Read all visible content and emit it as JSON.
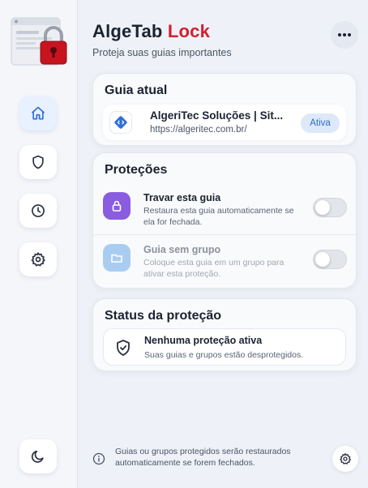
{
  "app": {
    "title_main": "AlgeTab",
    "title_accent": "Lock",
    "subtitle": "Proteja suas guias importantes",
    "accent_color": "#d0202e"
  },
  "sidebar": {
    "items": [
      {
        "icon": "home-icon",
        "active": true
      },
      {
        "icon": "shield-icon",
        "active": false
      },
      {
        "icon": "clock-icon",
        "active": false
      },
      {
        "icon": "gear-icon",
        "active": false
      }
    ],
    "bottom_icon": "moon-icon"
  },
  "current_tab": {
    "heading": "Guia atual",
    "title": "AlgeriTec Soluções | Sit...",
    "url": "https://algeritec.com.br/",
    "badge": "Ativa"
  },
  "protections": {
    "heading": "Proteções",
    "items": [
      {
        "title": "Travar esta guia",
        "description": "Restaura esta guia automaticamente se ela for fechada.",
        "icon": "lock-icon",
        "enabled": false,
        "disabled": false
      },
      {
        "title": "Guia sem grupo",
        "description": "Coloque esta guia em um grupo para ativar esta proteção.",
        "icon": "folder-icon",
        "enabled": false,
        "disabled": true
      }
    ]
  },
  "status": {
    "heading": "Status da proteção",
    "title": "Nenhuma proteção ativa",
    "description": "Suas guias e grupos estão desprotegidos."
  },
  "footer": {
    "text": "Guias ou grupos protegidos serão restaurados automaticamente se forem fechados."
  }
}
